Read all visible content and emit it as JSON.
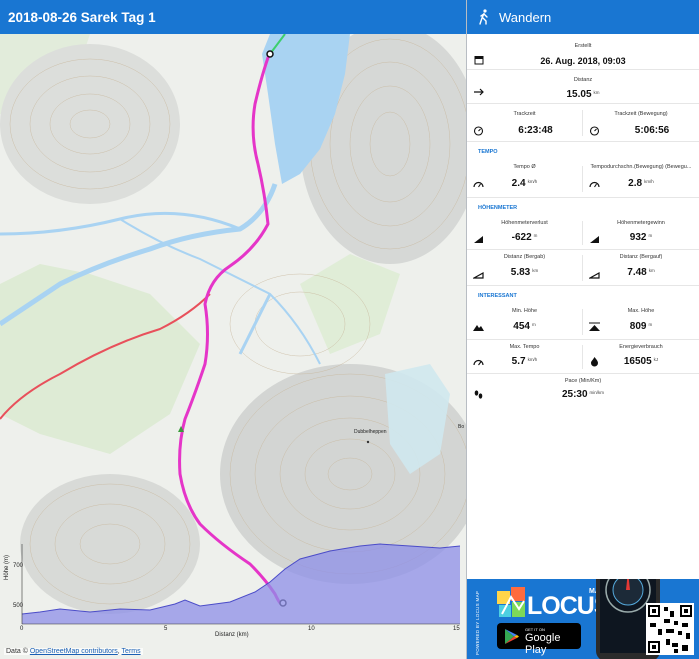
{
  "header": {
    "title": "2018-08-26 Sarek Tag 1",
    "activity": "Wandern"
  },
  "map": {
    "attribution_prefix": "Data © ",
    "attribution_link": "OpenStreetMap contributors",
    "attribution_sep": ", ",
    "terms": "Terms",
    "labels": [
      "Dubbelheppen",
      "Bo"
    ],
    "elevation_chart": {
      "y_label": "Höhe (m)",
      "y_ticks": [
        "700",
        "500"
      ],
      "x_label": "Distanz (km)",
      "x_ticks": [
        "0",
        "5",
        "10",
        "15"
      ]
    }
  },
  "stats": {
    "created": {
      "label": "Erstellt",
      "value": "26. Aug. 2018, 09:03"
    },
    "distance": {
      "label": "Distanz",
      "value": "15.05",
      "unit": "km"
    },
    "tracktime": {
      "label": "Trackzeit",
      "value": "6:23:48"
    },
    "tracktime_moving": {
      "label": "Trackzeit (Bewegung)",
      "value": "5:06:56"
    },
    "section_tempo": "TEMPO",
    "speed_avg": {
      "label": "Tempo Ø",
      "value": "2.4",
      "unit": "km/h"
    },
    "speed_avg_moving": {
      "label": "Tempodurchschn.(Bewegung) (Bewegu...",
      "value": "2.8",
      "unit": "km/h"
    },
    "section_elevation": "HÖHENMETER",
    "elev_loss": {
      "label": "Höhenmeterverlust",
      "value": "-622",
      "unit": "m"
    },
    "elev_gain": {
      "label": "Höhenmetergewinn",
      "value": "932",
      "unit": "m"
    },
    "dist_down": {
      "label": "Distanz (Bergab)",
      "value": "5.83",
      "unit": "km"
    },
    "dist_up": {
      "label": "Distanz (Bergauf)",
      "value": "7.48",
      "unit": "km"
    },
    "section_interesting": "INTERESSANT",
    "min_alt": {
      "label": "Min. Höhe",
      "value": "454",
      "unit": "m"
    },
    "max_alt": {
      "label": "Max. Höhe",
      "value": "809",
      "unit": "m"
    },
    "max_speed": {
      "label": "Max. Tempo",
      "value": "5.7",
      "unit": "km/h"
    },
    "energy": {
      "label": "Energieverbrauch",
      "value": "16505",
      "unit": "kJ"
    },
    "pace": {
      "label": "Pace (Min/Km)",
      "value": "25:30",
      "unit": "min/km"
    }
  },
  "promo": {
    "powered_by": "POWERED BY LOCUS MAP",
    "logo_map": "MAP",
    "logo_locus": "LOCUS",
    "gp_small": "GET IT ON",
    "gp_big": "Google Play"
  },
  "colors": {
    "accent": "#1976d2",
    "track": "#e535c8",
    "route": "#e8505b",
    "water": "#a9d3f2",
    "elevation_fill": "#8e8fe8"
  }
}
